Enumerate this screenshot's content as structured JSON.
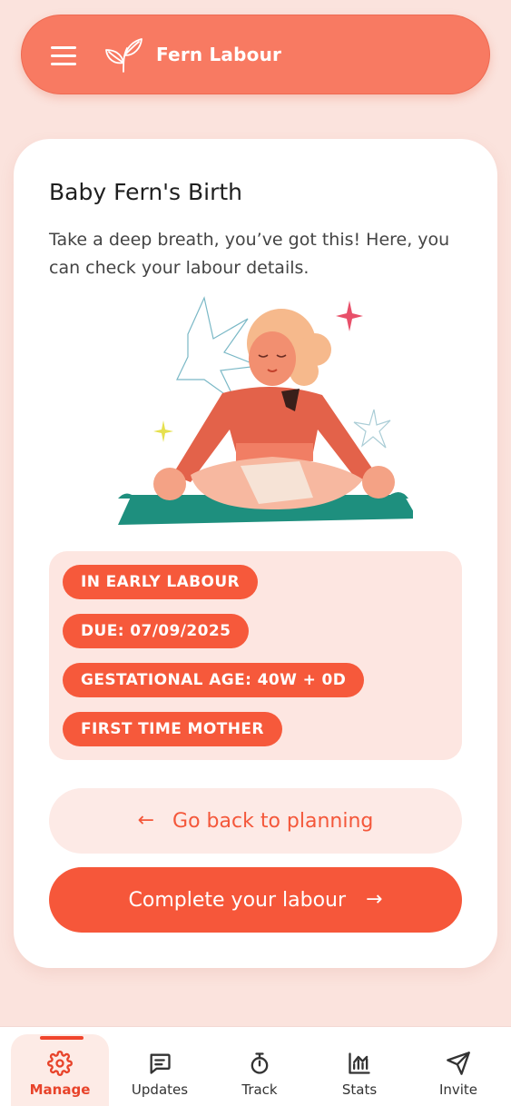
{
  "header": {
    "app_title": "Fern Labour",
    "menu_icon": "hamburger-menu-icon",
    "logo_icon": "fern-leaf-logo"
  },
  "card": {
    "title": "Baby Fern's Birth",
    "subtitle": "Take a deep breath, you’ve got this! Here, you can check your labour details.",
    "illustration": "woman-meditating-illustration"
  },
  "tags": [
    "IN EARLY LABOUR",
    "DUE: 07/09/2025",
    "GESTATIONAL AGE: 40W + 0D",
    "FIRST TIME MOTHER"
  ],
  "actions": {
    "back_label": "Go back to planning",
    "complete_label": "Complete your labour"
  },
  "nav": {
    "items": [
      {
        "label": "Manage",
        "icon": "gear-icon",
        "active": true
      },
      {
        "label": "Updates",
        "icon": "message-icon",
        "active": false
      },
      {
        "label": "Track",
        "icon": "stopwatch-icon",
        "active": false
      },
      {
        "label": "Stats",
        "icon": "chart-icon",
        "active": false
      },
      {
        "label": "Invite",
        "icon": "send-icon",
        "active": false
      }
    ]
  },
  "colors": {
    "accent": "#f6573a",
    "header": "#f87a62",
    "background": "#fbe3dd",
    "tag_panel": "#fde6e1"
  }
}
